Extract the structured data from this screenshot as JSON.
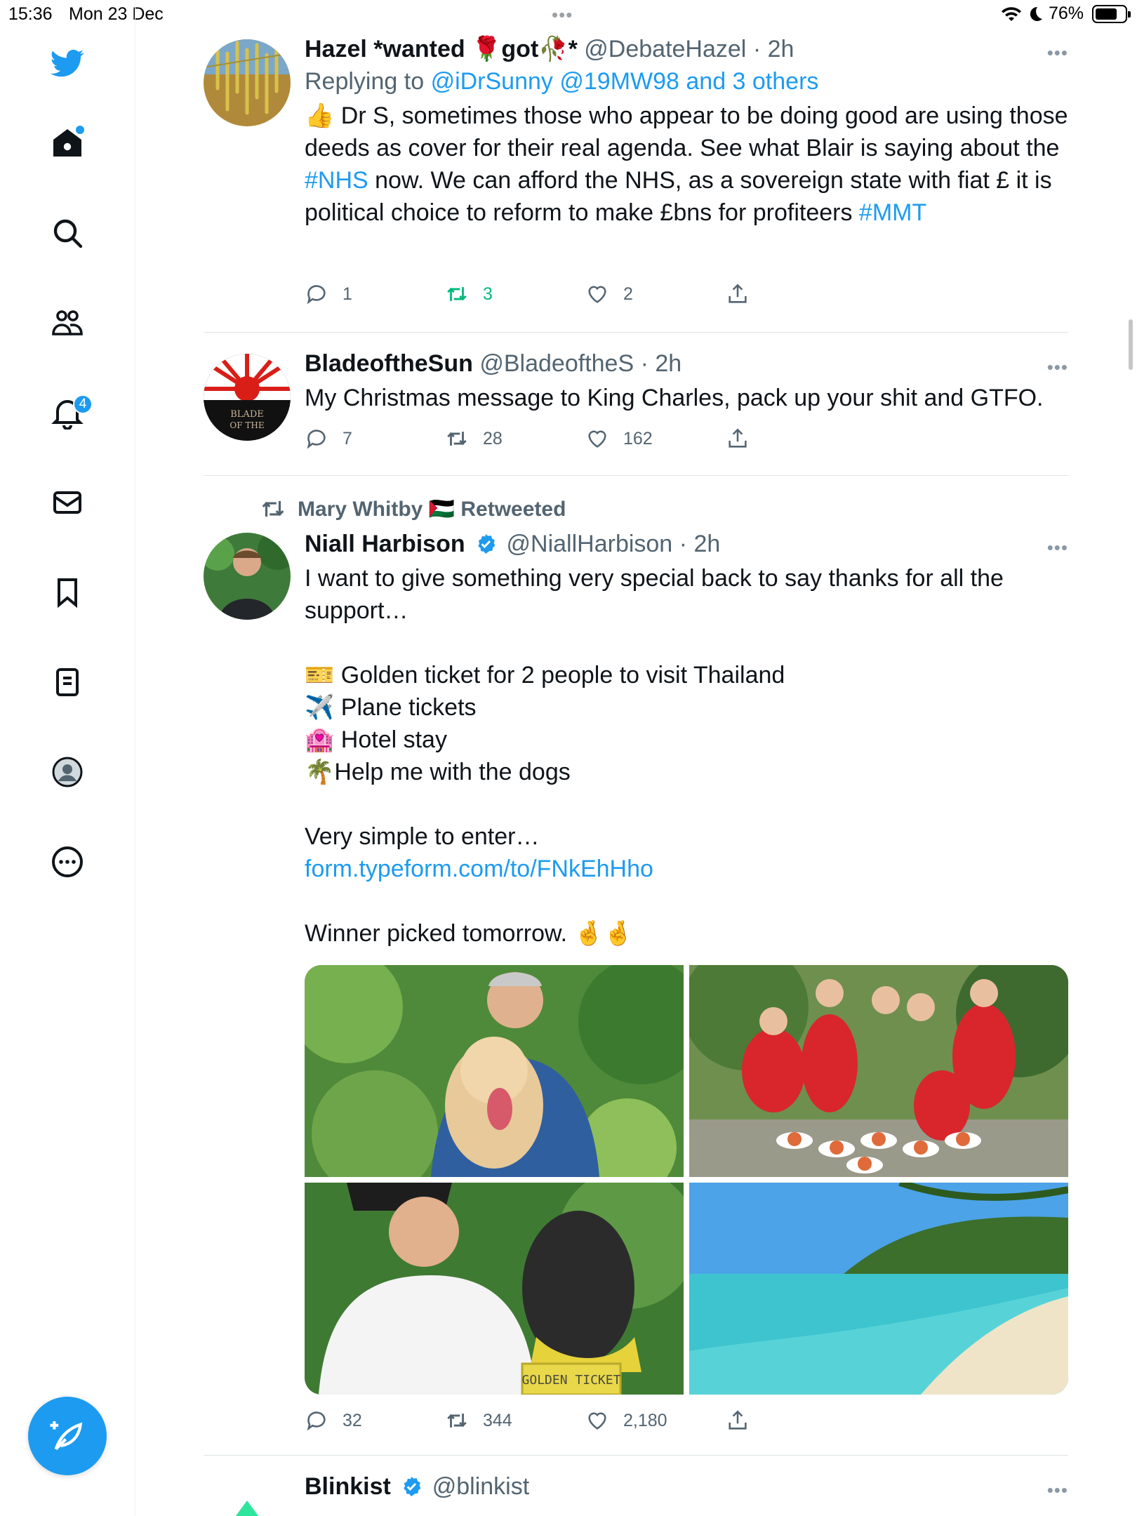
{
  "status_bar": {
    "time": "15:36",
    "date": "Mon 23 Dec",
    "battery": "76%",
    "battery_level": 0.76,
    "dots": "•••"
  },
  "sidebar": {
    "notifications_badge": "4",
    "items": [
      "twitter-logo",
      "home",
      "search",
      "communities",
      "notifications",
      "messages",
      "bookmarks",
      "lists",
      "profile",
      "more"
    ]
  },
  "tweets": [
    {
      "name": "Hazel *wanted 🌹got🥀*",
      "handle": "@DebateHazel",
      "time": "· 2h",
      "replying_label": "Replying to",
      "replying_to": "@iDrSunny @19MW98 and 3 others",
      "body_prefix": "👍 Dr S,  sometimes those who appear to be doing good are using those deeds as cover for their real agenda.  See what Blair is saying about the ",
      "hashtag1": "#NHS",
      "body_suffix": " now.  We can afford the NHS, as a sovereign state with fiat £ it is political choice to reform to make £bns for profiteers ",
      "hashtag2": "#MMT",
      "replies": "1",
      "retweets": "3",
      "likes": "2"
    },
    {
      "name": "BladeoftheSun",
      "handle": "@BladeoftheS",
      "time": "· 2h",
      "body": "My Christmas message to King Charles, pack up your shit and GTFO.",
      "avatar_text": "BLADE OF THE",
      "replies": "7",
      "retweets": "28",
      "likes": "162"
    },
    {
      "retweeted_by": "Mary Whitby 🇵🇸 Retweeted",
      "name": "Niall Harbison",
      "handle": "@NiallHarbison",
      "time": "· 2h",
      "lines": [
        "I want to give something very special back to say thanks for all the support…",
        "",
        "🎫 Golden ticket for 2 people to visit Thailand",
        "✈️ Plane tickets",
        "🏩 Hotel stay",
        "🌴Help me with the dogs",
        "",
        "Very simple to enter…"
      ],
      "link": "form.typeform.com/to/FNkEhHho",
      "closing": "Winner picked tomorrow. 🤞🤞",
      "media_sign": "GOLDEN TICKET",
      "replies": "32",
      "retweets": "344",
      "likes": "2,180"
    },
    {
      "name": "Blinkist",
      "handle": "@blinkist"
    }
  ],
  "colors": {
    "accent": "#1d9bf0",
    "retweet_active": "#00ba7c",
    "muted": "#536471"
  }
}
